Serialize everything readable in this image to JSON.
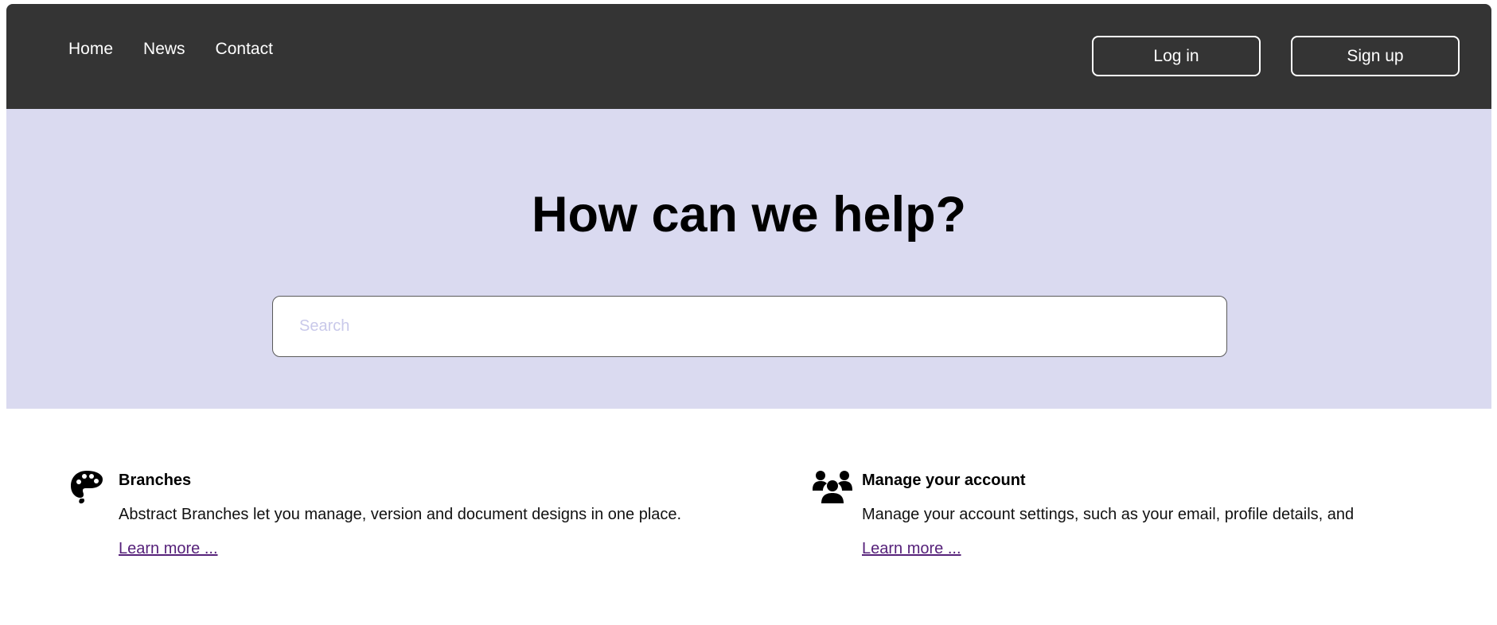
{
  "nav": {
    "items": [
      {
        "label": "Home"
      },
      {
        "label": "News"
      },
      {
        "label": "Contact"
      }
    ]
  },
  "auth": {
    "login_label": "Log in",
    "signup_label": "Sign up"
  },
  "hero": {
    "title": "How can we help?",
    "search_placeholder": "Search"
  },
  "cards": [
    {
      "icon": "palette-icon",
      "title": "Branches",
      "description": "Abstract Branches let you manage, version and document designs in one place.",
      "link": "Learn more ..."
    },
    {
      "icon": "users-icon",
      "title": "Manage your account",
      "description": "Manage your account settings, such as your email, profile details, and",
      "link": "Learn more ..."
    }
  ],
  "colors": {
    "header_bg": "#343434",
    "hero_bg": "#dadaf0",
    "link": "#56217a"
  }
}
